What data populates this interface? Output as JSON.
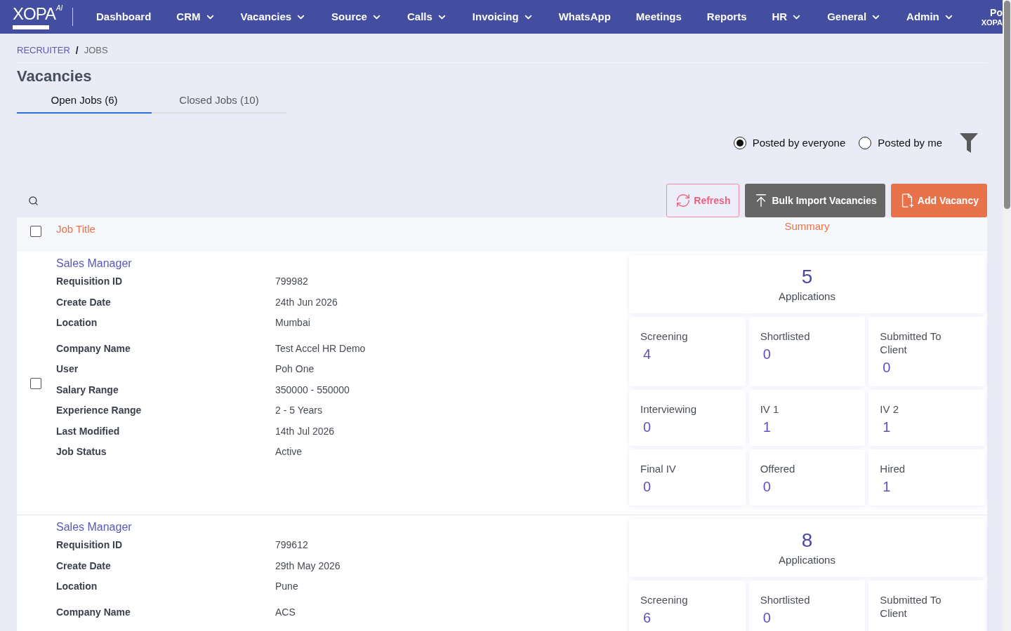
{
  "navbar": {
    "logo": {
      "text": "XOPA",
      "superscript": "AI"
    },
    "items": [
      {
        "label": "Dashboard",
        "dropdown": false
      },
      {
        "label": "CRM",
        "dropdown": true
      },
      {
        "label": "Vacancies",
        "dropdown": true
      },
      {
        "label": "Source",
        "dropdown": true
      },
      {
        "label": "Calls",
        "dropdown": true
      },
      {
        "label": "Invoicing",
        "dropdown": true
      },
      {
        "label": "WhatsApp",
        "dropdown": false
      },
      {
        "label": "Meetings",
        "dropdown": false
      },
      {
        "label": "Reports",
        "dropdown": false
      },
      {
        "label": "HR",
        "dropdown": true
      },
      {
        "label": "General",
        "dropdown": true
      },
      {
        "label": "Admin",
        "dropdown": true
      }
    ],
    "user": {
      "name": "Po",
      "company": "XOPA"
    }
  },
  "breadcrumb": {
    "separator": "/",
    "items": [
      {
        "label": "RECRUITER",
        "kind": "link"
      },
      {
        "label": "JOBS",
        "kind": "current"
      }
    ]
  },
  "page_title": "Vacancies",
  "tabs": [
    {
      "label": "Open Jobs (6)",
      "selected": true
    },
    {
      "label": "Closed Jobs (10)",
      "selected": false
    }
  ],
  "filters": {
    "radios": [
      {
        "label": "Posted by everyone",
        "selected": true
      },
      {
        "label": "Posted by me",
        "selected": false
      }
    ]
  },
  "toolbar": {
    "buttons": [
      {
        "label": "Refresh",
        "kind": "outline"
      },
      {
        "label": "Bulk Import Vacancies",
        "kind": "dark"
      },
      {
        "label": "Add Vacancy",
        "kind": "accent"
      }
    ]
  },
  "table": {
    "select_all": {
      "checked": false
    },
    "columns": [
      "Job Title",
      "Summary"
    ],
    "rows": [
      {
        "checked": false,
        "title": "Sales Manager",
        "fields": [
          {
            "label": "Requisition ID",
            "value": "799982"
          },
          {
            "label": "Create Date",
            "value": "24th Jun 2026"
          },
          {
            "label": "Location",
            "value": "Mumbai"
          },
          {
            "label": "Company Name",
            "value": "Test Accel HR Demo"
          },
          {
            "label": "User",
            "value": "Poh One"
          },
          {
            "label": "Salary Range",
            "value": "350000 - 550000"
          },
          {
            "label": "Experience Range",
            "value": "2 - 5 Years"
          },
          {
            "label": "Last Modified",
            "value": "14th Jul 2026"
          },
          {
            "label": "Job Status",
            "value": "Active"
          }
        ],
        "summary": {
          "count": "5",
          "count_label": "Applications",
          "stages": [
            {
              "label": "Screening",
              "value": "4"
            },
            {
              "label": "Shortlisted",
              "value": "0"
            },
            {
              "label": "Submitted To Client",
              "value": "0"
            },
            {
              "label": "Interviewing",
              "value": "0"
            },
            {
              "label": "IV 1",
              "value": "1"
            },
            {
              "label": "IV 2",
              "value": "1"
            },
            {
              "label": "Final IV",
              "value": "0"
            },
            {
              "label": "Offered",
              "value": "0"
            },
            {
              "label": "Hired",
              "value": "1"
            }
          ]
        }
      },
      {
        "title": "Sales Manager",
        "fields": [
          {
            "label": "Requisition ID",
            "value": "799612"
          },
          {
            "label": "Create Date",
            "value": "29th May 2026"
          },
          {
            "label": "Location",
            "value": "Pune"
          },
          {
            "label": "Company Name",
            "value": "ACS"
          }
        ],
        "summary": {
          "count": "8",
          "count_label": "Applications",
          "stages": [
            {
              "label": "Screening",
              "value": "6"
            },
            {
              "label": "Shortlisted",
              "value": "0"
            },
            {
              "label": "Submitted To Client"
            }
          ]
        }
      }
    ]
  }
}
